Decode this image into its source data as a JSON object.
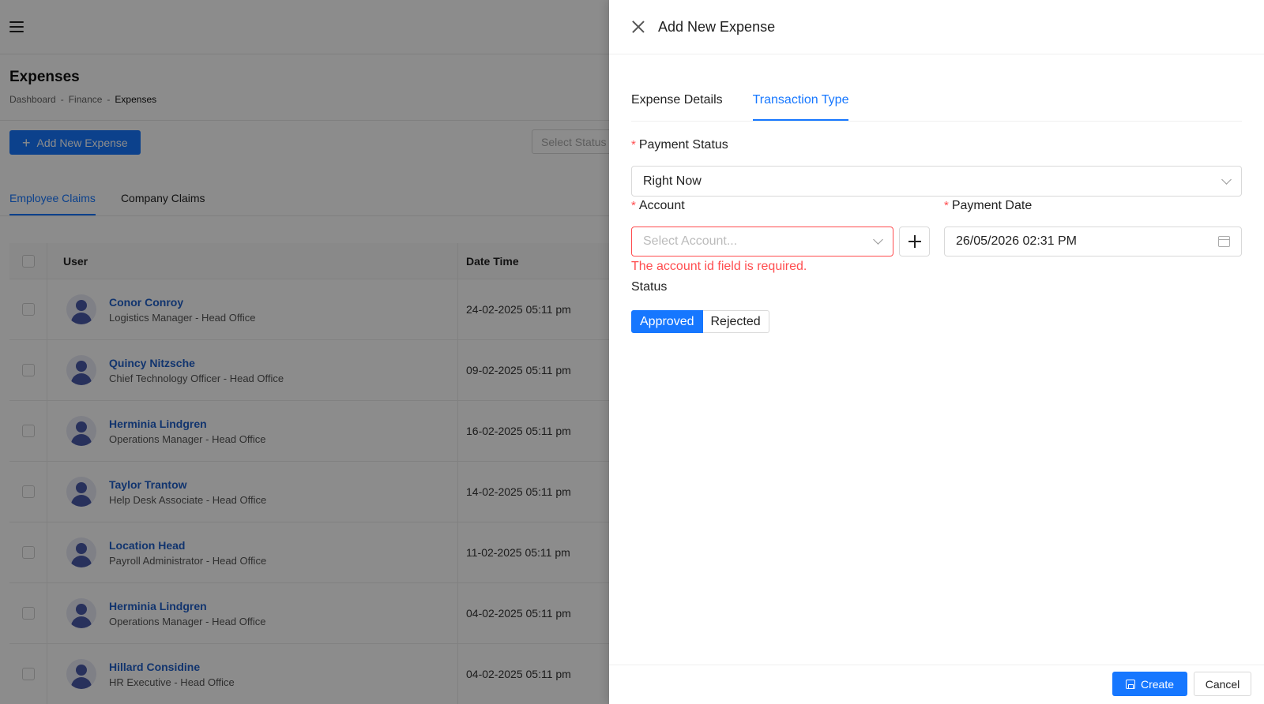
{
  "page": {
    "title": "Expenses",
    "breadcrumb": [
      "Dashboard",
      "Finance",
      "Expenses"
    ],
    "add_button_label": "Add New Expense",
    "select_status_placeholder": "Select Status",
    "claims_tabs": [
      "Employee Claims",
      "Company Claims"
    ],
    "table": {
      "columns": [
        "User",
        "Date Time"
      ],
      "rows": [
        {
          "name": "Conor Conroy",
          "role": "Logistics Manager - Head Office",
          "date": "24-02-2025 05:11 pm"
        },
        {
          "name": "Quincy Nitzsche",
          "role": "Chief Technology Officer - Head Office",
          "date": "09-02-2025 05:11 pm"
        },
        {
          "name": "Herminia Lindgren",
          "role": "Operations Manager - Head Office",
          "date": "16-02-2025 05:11 pm"
        },
        {
          "name": "Taylor Trantow",
          "role": "Help Desk Associate - Head Office",
          "date": "14-02-2025 05:11 pm"
        },
        {
          "name": "Location Head",
          "role": "Payroll Administrator - Head Office",
          "date": "11-02-2025 05:11 pm"
        },
        {
          "name": "Herminia Lindgren",
          "role": "Operations Manager - Head Office",
          "date": "04-02-2025 05:11 pm"
        },
        {
          "name": "Hillard Considine",
          "role": "HR Executive - Head Office",
          "date": "04-02-2025 05:11 pm"
        }
      ]
    }
  },
  "drawer": {
    "title": "Add New Expense",
    "tabs": [
      "Expense Details",
      "Transaction Type"
    ],
    "payment_status": {
      "label": "Payment Status",
      "value": "Right Now"
    },
    "account": {
      "label": "Account",
      "placeholder": "Select Account...",
      "error": "The account id field is required."
    },
    "payment_date": {
      "label": "Payment Date",
      "value": "26/05/2026 02:31 PM"
    },
    "status": {
      "label": "Status",
      "options": [
        "Approved",
        "Rejected"
      ],
      "selected": "Approved"
    },
    "footer": {
      "create_label": "Create",
      "cancel_label": "Cancel"
    }
  },
  "colors": {
    "primary": "#1677ff",
    "error": "#ff4d4f",
    "link": "#1f5fc9"
  }
}
